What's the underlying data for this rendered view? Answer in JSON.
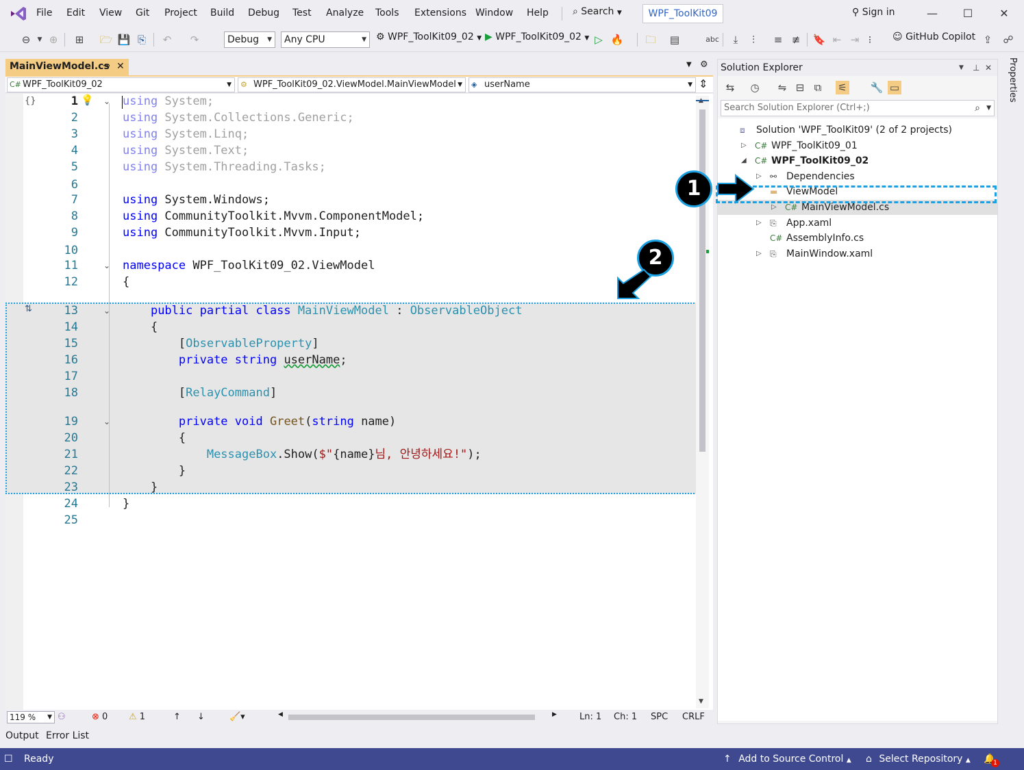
{
  "menubar": {
    "items": [
      "File",
      "Edit",
      "View",
      "Git",
      "Project",
      "Build",
      "Debug",
      "Test",
      "Analyze",
      "Tools",
      "Extensions",
      "Window",
      "Help"
    ],
    "search_label": "Search",
    "solution_name": "WPF_ToolKit09",
    "sign_in": "Sign in"
  },
  "toolbar": {
    "config": "Debug",
    "platform": "Any CPU",
    "startup_project": "WPF_ToolKit09_02",
    "run_target": "WPF_ToolKit09_02",
    "copilot": "GitHub Copilot"
  },
  "editor": {
    "tab_title": "MainViewModel.cs",
    "nav_project": "WPF_ToolKit09_02",
    "nav_class": "WPF_ToolKit09_02.ViewModel.MainViewModel",
    "nav_member": "userName",
    "lines": [
      {
        "n": "1",
        "t": [
          [
            "faded-kw",
            "using"
          ],
          [
            "faded",
            " System;"
          ]
        ]
      },
      {
        "n": "2",
        "t": [
          [
            "faded-kw",
            "using"
          ],
          [
            "faded",
            " System.Collections.Generic;"
          ]
        ]
      },
      {
        "n": "3",
        "t": [
          [
            "faded-kw",
            "using"
          ],
          [
            "faded",
            " System.Linq;"
          ]
        ]
      },
      {
        "n": "4",
        "t": [
          [
            "faded-kw",
            "using"
          ],
          [
            "faded",
            " System.Text;"
          ]
        ]
      },
      {
        "n": "5",
        "t": [
          [
            "faded-kw",
            "using"
          ],
          [
            "faded",
            " System.Threading.Tasks;"
          ]
        ]
      },
      {
        "n": "6",
        "t": []
      },
      {
        "n": "7",
        "t": [
          [
            "kw",
            "using"
          ],
          [
            "ident",
            " System.Windows;"
          ]
        ]
      },
      {
        "n": "8",
        "t": [
          [
            "kw",
            "using"
          ],
          [
            "ident",
            " CommunityToolkit.Mvvm.ComponentModel;"
          ]
        ]
      },
      {
        "n": "9",
        "t": [
          [
            "kw",
            "using"
          ],
          [
            "ident",
            " CommunityToolkit.Mvvm.Input;"
          ]
        ]
      },
      {
        "n": "10",
        "t": []
      },
      {
        "n": "11",
        "t": [
          [
            "kw",
            "namespace"
          ],
          [
            "ident",
            " WPF_ToolKit09_02.ViewModel"
          ]
        ]
      },
      {
        "n": "12",
        "t": [
          [
            "ident",
            "{"
          ]
        ]
      },
      {
        "n": "13",
        "t": [
          [
            "ident",
            "    "
          ],
          [
            "kw",
            "public partial class"
          ],
          [
            "ident",
            " "
          ],
          [
            "type",
            "MainViewModel"
          ],
          [
            "ident",
            " : "
          ],
          [
            "type",
            "ObservableObject"
          ]
        ]
      },
      {
        "n": "14",
        "t": [
          [
            "ident",
            "    {"
          ]
        ]
      },
      {
        "n": "15",
        "t": [
          [
            "ident",
            "        ["
          ],
          [
            "type",
            "ObservableProperty"
          ],
          [
            "ident",
            "]"
          ]
        ]
      },
      {
        "n": "16",
        "t": [
          [
            "ident",
            "        "
          ],
          [
            "kw",
            "private string"
          ],
          [
            "ident",
            " "
          ],
          [
            "squiggle",
            "userName"
          ],
          [
            "ident",
            ";"
          ]
        ]
      },
      {
        "n": "17",
        "t": []
      },
      {
        "n": "18",
        "t": [
          [
            "ident",
            "        ["
          ],
          [
            "type",
            "RelayCommand"
          ],
          [
            "ident",
            "]"
          ]
        ]
      },
      {
        "n": "19",
        "t": [
          [
            "ident",
            "        "
          ],
          [
            "kw",
            "private void"
          ],
          [
            "ident",
            " "
          ],
          [
            "fn",
            "Greet"
          ],
          [
            "ident",
            "("
          ],
          [
            "kw",
            "string"
          ],
          [
            "ident",
            " name)"
          ]
        ]
      },
      {
        "n": "20",
        "t": [
          [
            "ident",
            "        {"
          ]
        ]
      },
      {
        "n": "21",
        "t": [
          [
            "ident",
            "            "
          ],
          [
            "type",
            "MessageBox"
          ],
          [
            "ident",
            ".Show("
          ],
          [
            "str",
            "$\""
          ],
          [
            "ident",
            "{name}"
          ],
          [
            "str",
            "님, 안녕하세요!\""
          ],
          [
            "ident",
            ");"
          ]
        ]
      },
      {
        "n": "22",
        "t": [
          [
            "ident",
            "        }"
          ]
        ]
      },
      {
        "n": "23",
        "t": [
          [
            "ident",
            "    }"
          ]
        ]
      },
      {
        "n": "24",
        "t": [
          [
            "ident",
            "}"
          ]
        ]
      },
      {
        "n": "25",
        "t": []
      }
    ]
  },
  "editor_status": {
    "zoom": "119 %",
    "errors": "0",
    "warnings": "1",
    "line": "Ln: 1",
    "col": "Ch: 1",
    "spacing": "SPC",
    "eol": "CRLF"
  },
  "bottom_tabs": [
    "Output",
    "Error List"
  ],
  "statusbar": {
    "ready": "Ready",
    "source_control": "Add to Source Control",
    "repo": "Select Repository",
    "notification_count": "1"
  },
  "solution_explorer": {
    "title": "Solution Explorer",
    "search_placeholder": "Search Solution Explorer (Ctrl+;)",
    "tree": [
      {
        "label": "Solution 'WPF_ToolKit09' (2 of 2 projects)",
        "icon": "solution-icon",
        "depth": 0,
        "expander": ""
      },
      {
        "label": "WPF_ToolKit09_01",
        "icon": "csproj-icon",
        "depth": 1,
        "expander": "▷"
      },
      {
        "label": "WPF_ToolKit09_02",
        "icon": "csproj-icon",
        "depth": 1,
        "expander": "◢",
        "bold": true
      },
      {
        "label": "Dependencies",
        "icon": "dependencies-icon",
        "depth": 2,
        "expander": "▷"
      },
      {
        "label": "ViewModel",
        "icon": "folder-icon",
        "depth": 2,
        "expander": ""
      },
      {
        "label": "MainViewModel.cs",
        "icon": "csharp-file-icon",
        "depth": 3,
        "expander": "▷"
      },
      {
        "label": "App.xaml",
        "icon": "xaml-file-icon",
        "depth": 2,
        "expander": "▷"
      },
      {
        "label": "AssemblyInfo.cs",
        "icon": "csharp-file-icon",
        "depth": 2,
        "expander": ""
      },
      {
        "label": "MainWindow.xaml",
        "icon": "xaml-file-icon",
        "depth": 2,
        "expander": "▷"
      }
    ]
  },
  "properties_tab": "Properties",
  "callouts": [
    "1",
    "2"
  ],
  "colors": {
    "accent": "#1ba1e2",
    "statusbar": "#3f4990",
    "tab_active": "#f5cc84"
  }
}
